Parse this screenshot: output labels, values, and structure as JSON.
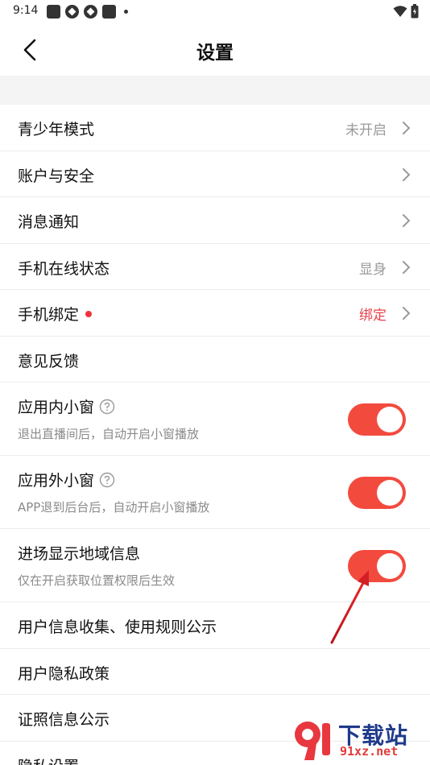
{
  "status_bar": {
    "time": "9:14"
  },
  "header": {
    "title": "设置"
  },
  "rows": [
    {
      "label": "青少年模式",
      "value": "未开启"
    },
    {
      "label": "账户与安全"
    },
    {
      "label": "消息通知"
    },
    {
      "label": "手机在线状态",
      "value": "显身"
    },
    {
      "label": "手机绑定",
      "value": "绑定"
    },
    {
      "label": "意见反馈"
    },
    {
      "label": "应用内小窗",
      "sub": "退出直播间后，自动开启小窗播放",
      "toggle": true
    },
    {
      "label": "应用外小窗",
      "sub": "APP退到后台后，自动开启小窗播放",
      "toggle": true
    },
    {
      "label": "进场显示地域信息",
      "sub": "仅在开启获取位置权限后生效",
      "toggle": true
    },
    {
      "label": "用户信息收集、使用规则公示"
    },
    {
      "label": "用户隐私政策"
    },
    {
      "label": "证照信息公示"
    },
    {
      "label": "隐私设置"
    }
  ],
  "colors": {
    "accent": "#f34a3e",
    "bind_red": "#e8404a"
  },
  "watermark": {
    "brand": "下载站",
    "url": "91xz.net"
  }
}
